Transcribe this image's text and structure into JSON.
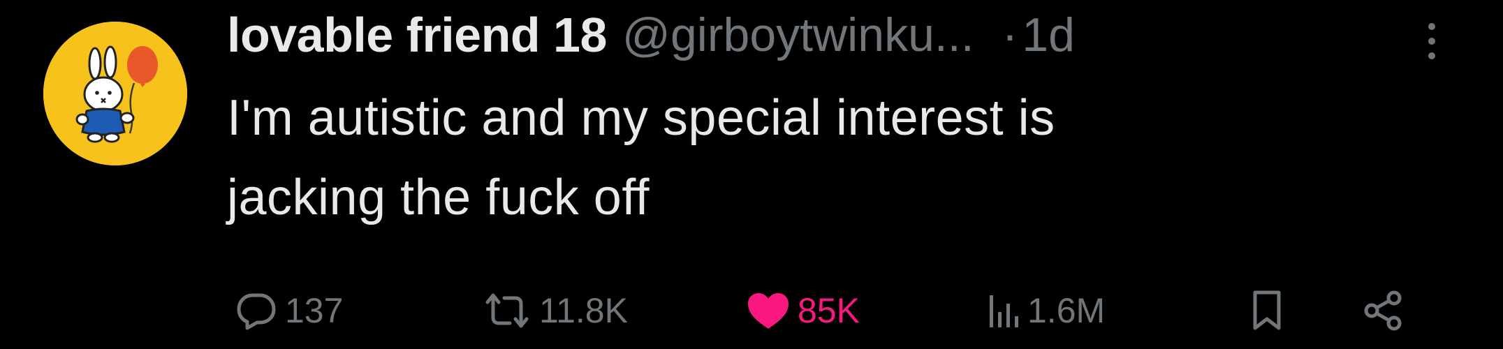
{
  "tweet": {
    "author": {
      "display_name": "lovable friend 18",
      "handle": "@girboytwinku...",
      "avatar_icon": "miffy-with-balloon-avatar"
    },
    "separator": "·",
    "timestamp": "1d",
    "text_lines": [
      "I'm autistic and my special interest is",
      "jacking the fuck off"
    ]
  },
  "actions": {
    "reply_count": "137",
    "retweet_count": "11.8K",
    "like_count": "85K",
    "views_count": "1.6M"
  },
  "colors": {
    "background": "#000000",
    "primary_text": "#e7e9ea",
    "secondary_text": "#71767b",
    "like_active": "#f91880",
    "avatar_bg": "#f6c21b"
  },
  "icons": {
    "more": "more-vertical-icon",
    "reply": "reply-bubble-icon",
    "retweet": "retweet-icon",
    "like": "heart-filled-icon",
    "views": "views-bar-chart-icon",
    "bookmark": "bookmark-icon",
    "share": "share-icon"
  }
}
